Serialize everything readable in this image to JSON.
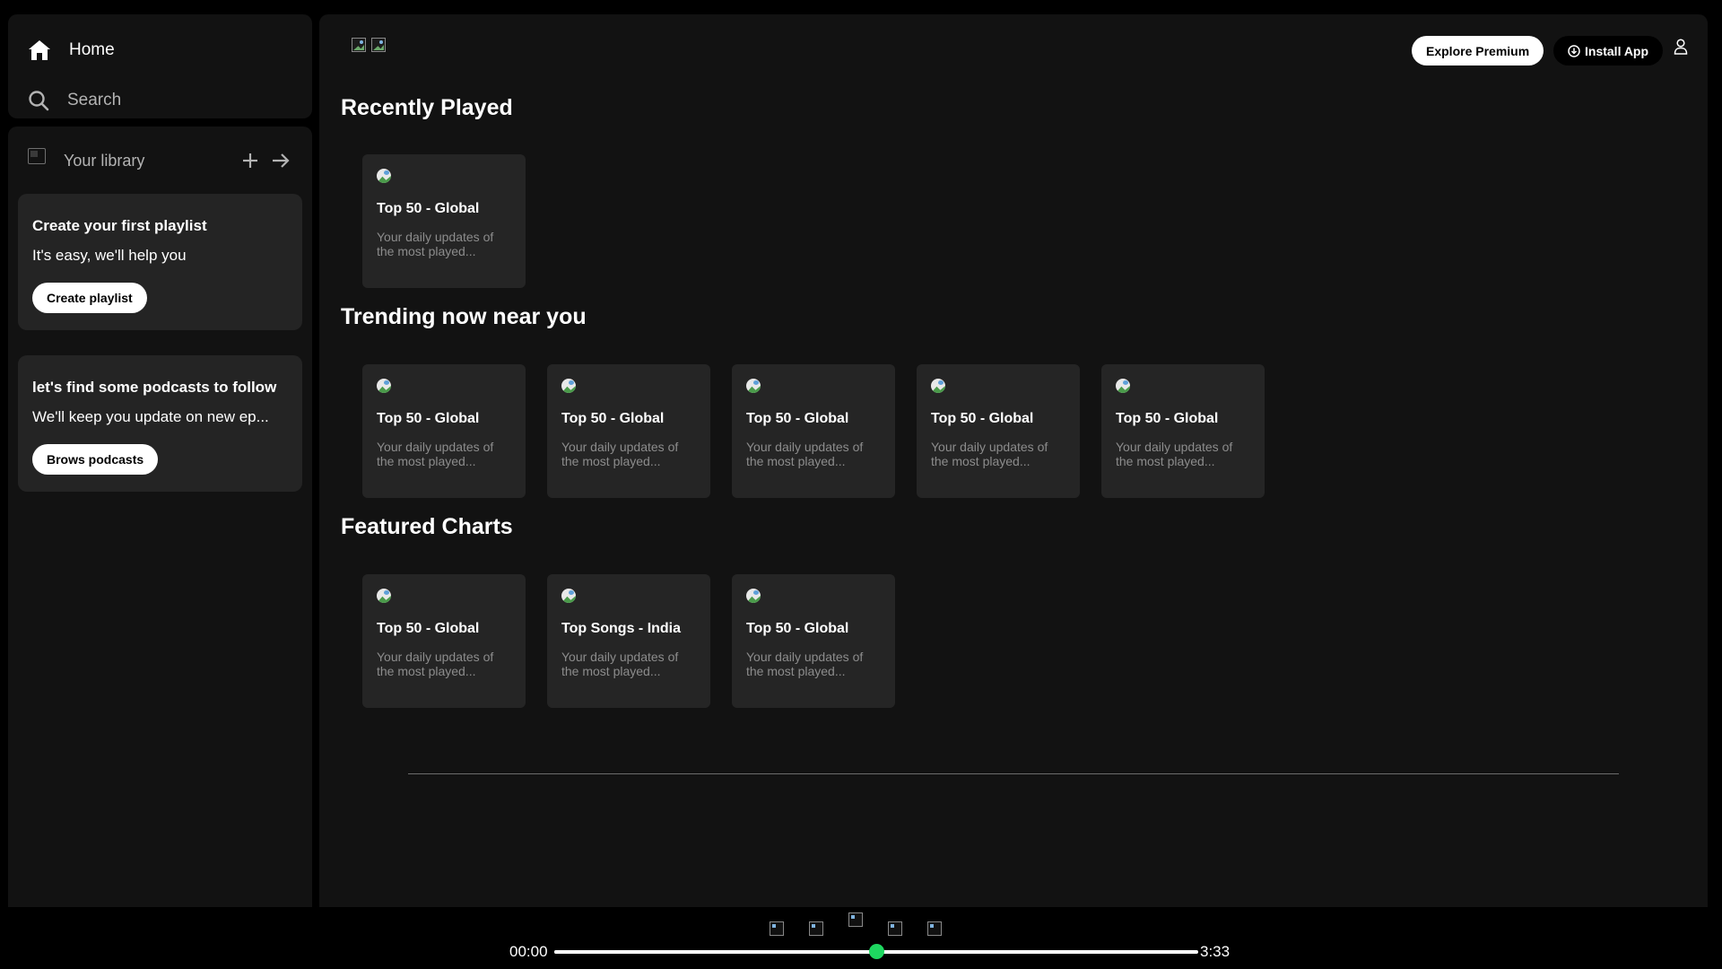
{
  "sidebar": {
    "home_label": "Home",
    "search_label": "Search",
    "library_label": "Your library",
    "playlist_promo": {
      "title": "Create your first playlist",
      "subtitle": "It's easy, we'll help you",
      "button": "Create playlist"
    },
    "podcast_promo": {
      "title": "let's find some podcasts to follow",
      "subtitle": "We'll keep you update on new ep...",
      "button": "Brows podcasts"
    }
  },
  "header": {
    "explore_premium": "Explore Premium",
    "install_app": "Install App"
  },
  "sections": [
    {
      "title": "Recently Played",
      "cards": [
        {
          "title": "Top 50 - Global",
          "desc": "Your daily updates of the most played..."
        }
      ]
    },
    {
      "title": "Trending now near you",
      "cards": [
        {
          "title": "Top 50 - Global",
          "desc": "Your daily updates of the most played..."
        },
        {
          "title": "Top 50 - Global",
          "desc": "Your daily updates of the most played..."
        },
        {
          "title": "Top 50 - Global",
          "desc": "Your daily updates of the most played..."
        },
        {
          "title": "Top 50 - Global",
          "desc": "Your daily updates of the most played..."
        },
        {
          "title": "Top 50 - Global",
          "desc": "Your daily updates of the most played..."
        }
      ]
    },
    {
      "title": "Featured Charts",
      "cards": [
        {
          "title": "Top 50 - Global",
          "desc": "Your daily updates of the most played..."
        },
        {
          "title": "Top Songs - India",
          "desc": "Your daily updates of the most played..."
        },
        {
          "title": "Top 50 - Global",
          "desc": "Your daily updates of the most played..."
        }
      ]
    }
  ],
  "player": {
    "current_time": "00:00",
    "total_time": "3:33",
    "progress": 0.5
  },
  "colors": {
    "accent": "#1ed760",
    "panel": "#121212",
    "card": "#252525"
  }
}
